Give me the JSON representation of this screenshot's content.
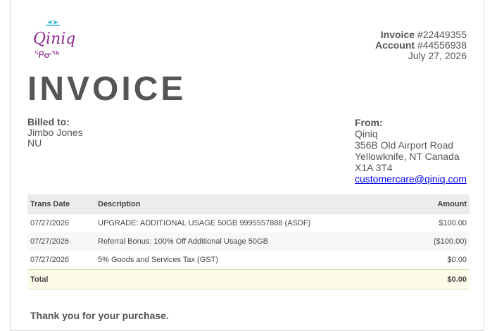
{
  "brand": {
    "logo_text": "Qiniq",
    "logo_syllabics": "ᕿᓂᖅ",
    "accent": "#8e2a8e",
    "eye_color": "#3cb8d6"
  },
  "invoice": {
    "invoice_label": "Invoice",
    "invoice_number": "#22449355",
    "account_label": "Account",
    "account_number": "#44556938",
    "date": "July 27, 2026",
    "title": "INVOICE"
  },
  "billed_to": {
    "label": "Billed to:",
    "name": "Jimbo Jones",
    "region": "NU"
  },
  "from": {
    "label": "From:",
    "company": "Qiniq",
    "address1": "356B Old Airport Road",
    "address2": "Yellowknife, NT Canada",
    "postal": "X1A 3T4",
    "email": "customercare@qiniq.com"
  },
  "table": {
    "headers": {
      "date": "Trans Date",
      "description": "Description",
      "amount": "Amount"
    },
    "rows": [
      {
        "date": "07/27/2026",
        "description": "UPGRADE: ADDITIONAL USAGE 50GB 9995557888 (ASDF)",
        "amount": "$100.00"
      },
      {
        "date": "07/27/2026",
        "description": "Referral Bonus: 100% Off Additional Usage 50GB",
        "amount": "($100.00)"
      },
      {
        "date": "07/27/2026",
        "description": "5% Goods and Services Tax (GST)",
        "amount": "$0.00"
      }
    ],
    "total": {
      "label": "Total",
      "amount": "$0.00"
    }
  },
  "footer": {
    "thanks": "Thank you for your purchase."
  }
}
